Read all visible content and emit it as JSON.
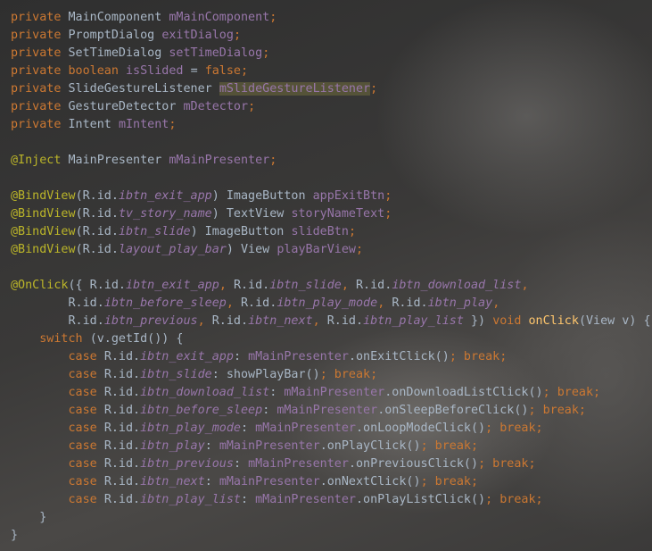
{
  "editor": {
    "language": "java",
    "colors": {
      "keyword": "#cc7832",
      "text": "#a9b7c6",
      "field": "#9876aa",
      "annotation": "#bbb529",
      "method_declaration": "#ffc66d",
      "highlight": "#706c3c"
    },
    "highlighted_token": "mSlideGestureListener",
    "lines": [
      [
        [
          "kw",
          "private "
        ],
        [
          "type",
          "MainComponent "
        ],
        [
          "field",
          "mMainComponent"
        ],
        [
          "kw",
          ";"
        ]
      ],
      [
        [
          "kw",
          "private "
        ],
        [
          "type",
          "PromptDialog "
        ],
        [
          "field",
          "exitDialog"
        ],
        [
          "kw",
          ";"
        ]
      ],
      [
        [
          "kw",
          "private "
        ],
        [
          "type",
          "SetTimeDialog "
        ],
        [
          "field",
          "setTimeDialog"
        ],
        [
          "kw",
          ";"
        ]
      ],
      [
        [
          "kw",
          "private boolean "
        ],
        [
          "field",
          "isSlided "
        ],
        [
          "txt",
          "= "
        ],
        [
          "kw",
          "false;"
        ]
      ],
      [
        [
          "kw",
          "private "
        ],
        [
          "type",
          "SlideGestureListener "
        ],
        [
          "field hl",
          "mSlideGestureListener"
        ],
        [
          "kw",
          ";"
        ]
      ],
      [
        [
          "kw",
          "private "
        ],
        [
          "type",
          "GestureDetector "
        ],
        [
          "field",
          "mDetector"
        ],
        [
          "kw",
          ";"
        ]
      ],
      [
        [
          "kw",
          "private "
        ],
        [
          "type",
          "Intent "
        ],
        [
          "field",
          "mIntent"
        ],
        [
          "kw",
          ";"
        ]
      ],
      [],
      [
        [
          "ann",
          "@Inject "
        ],
        [
          "type",
          "MainPresenter "
        ],
        [
          "field",
          "mMainPresenter"
        ],
        [
          "kw",
          ";"
        ]
      ],
      [],
      [
        [
          "ann",
          "@BindView"
        ],
        [
          "txt",
          "(R.id."
        ],
        [
          "res",
          "ibtn_exit_app"
        ],
        [
          "txt",
          ") ImageButton "
        ],
        [
          "field",
          "appExitBtn"
        ],
        [
          "kw",
          ";"
        ]
      ],
      [
        [
          "ann",
          "@BindView"
        ],
        [
          "txt",
          "(R.id."
        ],
        [
          "res",
          "tv_story_name"
        ],
        [
          "txt",
          ") TextView "
        ],
        [
          "field",
          "storyNameText"
        ],
        [
          "kw",
          ";"
        ]
      ],
      [
        [
          "ann",
          "@BindView"
        ],
        [
          "txt",
          "(R.id."
        ],
        [
          "res",
          "ibtn_slide"
        ],
        [
          "txt",
          ") ImageButton "
        ],
        [
          "field",
          "slideBtn"
        ],
        [
          "kw",
          ";"
        ]
      ],
      [
        [
          "ann",
          "@BindView"
        ],
        [
          "txt",
          "(R.id."
        ],
        [
          "res",
          "layout_play_bar"
        ],
        [
          "txt",
          ") View "
        ],
        [
          "field",
          "playBarView"
        ],
        [
          "kw",
          ";"
        ]
      ],
      [],
      [
        [
          "ann",
          "@OnClick"
        ],
        [
          "txt",
          "({ R.id."
        ],
        [
          "res",
          "ibtn_exit_app"
        ],
        [
          "kw",
          ", "
        ],
        [
          "txt",
          "R.id."
        ],
        [
          "res",
          "ibtn_slide"
        ],
        [
          "kw",
          ", "
        ],
        [
          "txt",
          "R.id."
        ],
        [
          "res",
          "ibtn_download_list"
        ],
        [
          "kw",
          ","
        ]
      ],
      [
        [
          "txt",
          "        R.id."
        ],
        [
          "res",
          "ibtn_before_sleep"
        ],
        [
          "kw",
          ", "
        ],
        [
          "txt",
          "R.id."
        ],
        [
          "res",
          "ibtn_play_mode"
        ],
        [
          "kw",
          ", "
        ],
        [
          "txt",
          "R.id."
        ],
        [
          "res",
          "ibtn_play"
        ],
        [
          "kw",
          ","
        ]
      ],
      [
        [
          "txt",
          "        R.id."
        ],
        [
          "res",
          "ibtn_previous"
        ],
        [
          "kw",
          ", "
        ],
        [
          "txt",
          "R.id."
        ],
        [
          "res",
          "ibtn_next"
        ],
        [
          "kw",
          ", "
        ],
        [
          "txt",
          "R.id."
        ],
        [
          "res",
          "ibtn_play_list "
        ],
        [
          "txt",
          "}) "
        ],
        [
          "kw",
          "void "
        ],
        [
          "fn",
          "onClick"
        ],
        [
          "txt",
          "(View v) {"
        ]
      ],
      [
        [
          "kw",
          "    switch "
        ],
        [
          "txt",
          "(v.getId()) {"
        ]
      ],
      [
        [
          "kw",
          "        case "
        ],
        [
          "txt",
          "R.id."
        ],
        [
          "res",
          "ibtn_exit_app"
        ],
        [
          "txt",
          ": "
        ],
        [
          "field",
          "mMainPresenter"
        ],
        [
          "txt",
          ".onExitClick()"
        ],
        [
          "kw",
          "; break;"
        ]
      ],
      [
        [
          "kw",
          "        case "
        ],
        [
          "txt",
          "R.id."
        ],
        [
          "res",
          "ibtn_slide"
        ],
        [
          "txt",
          ": showPlayBar()"
        ],
        [
          "kw",
          "; break;"
        ]
      ],
      [
        [
          "kw",
          "        case "
        ],
        [
          "txt",
          "R.id."
        ],
        [
          "res",
          "ibtn_download_list"
        ],
        [
          "txt",
          ": "
        ],
        [
          "field",
          "mMainPresenter"
        ],
        [
          "txt",
          ".onDownloadListClick()"
        ],
        [
          "kw",
          "; break;"
        ]
      ],
      [
        [
          "kw",
          "        case "
        ],
        [
          "txt",
          "R.id."
        ],
        [
          "res",
          "ibtn_before_sleep"
        ],
        [
          "txt",
          ": "
        ],
        [
          "field",
          "mMainPresenter"
        ],
        [
          "txt",
          ".onSleepBeforeClick()"
        ],
        [
          "kw",
          "; break;"
        ]
      ],
      [
        [
          "kw",
          "        case "
        ],
        [
          "txt",
          "R.id."
        ],
        [
          "res",
          "ibtn_play_mode"
        ],
        [
          "txt",
          ": "
        ],
        [
          "field",
          "mMainPresenter"
        ],
        [
          "txt",
          ".onLoopModeClick()"
        ],
        [
          "kw",
          "; break;"
        ]
      ],
      [
        [
          "kw",
          "        case "
        ],
        [
          "txt",
          "R.id."
        ],
        [
          "res",
          "ibtn_play"
        ],
        [
          "txt",
          ": "
        ],
        [
          "field",
          "mMainPresenter"
        ],
        [
          "txt",
          ".onPlayClick()"
        ],
        [
          "kw",
          "; break;"
        ]
      ],
      [
        [
          "kw",
          "        case "
        ],
        [
          "txt",
          "R.id."
        ],
        [
          "res",
          "ibtn_previous"
        ],
        [
          "txt",
          ": "
        ],
        [
          "field",
          "mMainPresenter"
        ],
        [
          "txt",
          ".onPreviousClick()"
        ],
        [
          "kw",
          "; break;"
        ]
      ],
      [
        [
          "kw",
          "        case "
        ],
        [
          "txt",
          "R.id."
        ],
        [
          "res",
          "ibtn_next"
        ],
        [
          "txt",
          ": "
        ],
        [
          "field",
          "mMainPresenter"
        ],
        [
          "txt",
          ".onNextClick()"
        ],
        [
          "kw",
          "; break;"
        ]
      ],
      [
        [
          "kw",
          "        case "
        ],
        [
          "txt",
          "R.id."
        ],
        [
          "res",
          "ibtn_play_list"
        ],
        [
          "txt",
          ": "
        ],
        [
          "field",
          "mMainPresenter"
        ],
        [
          "txt",
          ".onPlayListClick()"
        ],
        [
          "kw",
          "; break;"
        ]
      ],
      [
        [
          "txt",
          "    }"
        ]
      ],
      [
        [
          "txt",
          "}"
        ]
      ]
    ]
  }
}
